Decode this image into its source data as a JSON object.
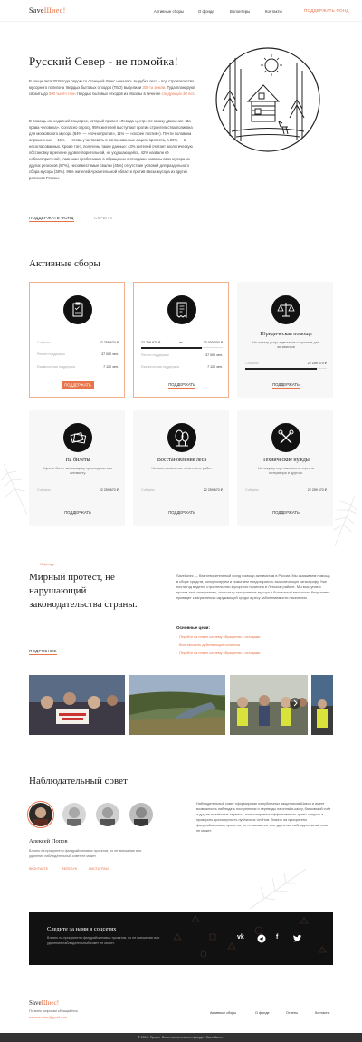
{
  "header": {
    "logo_a": "Save",
    "logo_b": "Шиес!",
    "nav": [
      "Активные сборы",
      "О фонде",
      "Волонтеры",
      "Контакты"
    ],
    "cta": "ПОДДЕРЖАТЬ ФОНД"
  },
  "hero": {
    "title": "Русский Север - не помойка!",
    "p1_a": "В конце лета 2018 года рядом со станцией Шиес началась вырубка леса - под строительство мусорного полигона твердых бытовых отходов (ТБО) выделили ",
    "p1_hl1": "300 га земли",
    "p1_b": ". Туда планируют свозить до ",
    "p1_hl2": "500 тысяч тонн",
    "p1_c": " твердых бытовых отходов из Москвы в течение ",
    "p1_hl3": "следующих 20 лет",
    "p1_d": ".",
    "p2": "В помощь им недавний соцопрос, который провел «Левада-центр» по заказу движения «За права человека». Согласно опросу, 95% жителей выступают против строительства полигона для московского мусора (84% — «точно против», 11% — «скорее против»). Почти половина опрошенных — 46% — готова участвовать в согласованных акциях протеста, а 25% — в несогласованных. Кроме того, получены такие данные: 43% жителей считает экологическую обстановку в регионе удовлетворительной, но ухудшающейся, 42% назвали её неблагоприятной; главными проблемами в обращении с отходами названы ввоз мусора из других регионов (67%), несовместимые свалки (45%) отсутствие условий для раздельного сбора мусора (38%). 96% жителей Архангельской области против ввоза мусора из других регионов России.",
    "support_link": "ПОДДЕРЖАТЬ ФОНД",
    "hide_link": "СКРЫТЬ"
  },
  "active": {
    "title": "Активные сборы",
    "cards": [
      {
        "icon": "clipboard-icon",
        "rows": [
          [
            "Собрано",
            "22 259 670 ₽"
          ],
          [
            "Регион поддержки",
            "37 000 чел."
          ],
          [
            "Ежемесячная поддержка",
            "7 120 чел."
          ]
        ],
        "btn": "ПОДДЕРЖАТЬ"
      },
      {
        "icon": "receipt-icon",
        "range_from": "22 259 670 ₽",
        "range_sep": "из",
        "range_to": "30 000 000 ₽",
        "progress": 0.74,
        "rows": [
          [
            "Регион поддержки",
            "37 000 чел."
          ],
          [
            "Ежемесячная поддержка",
            "7 120 чел."
          ]
        ],
        "btn": "ПОДДЕРЖАТЬ"
      },
      {
        "icon": "scales-icon",
        "title": "Юридическая помощь",
        "desc": "На оплату услуг адвокатов и юристов для активистов",
        "row": [
          "Собрано",
          "22 259 670 ₽"
        ],
        "progress": 0.88,
        "btn": "ПОДДЕРЖАТЬ"
      },
      {
        "icon": "tickets-icon",
        "title": "На билеты",
        "desc": "Купить билет желающему присоединиться активисту.",
        "row": [
          "Собрано",
          "22 259 670 ₽"
        ],
        "btn": "ПОДДЕРЖАТЬ"
      },
      {
        "icon": "trees-icon",
        "title": "Восстановление леса",
        "desc": "На восстановление леса после работ.",
        "row": [
          "Собрано",
          "22 259 670 ₽"
        ],
        "btn": "ПОДДЕРЖАТЬ"
      },
      {
        "icon": "tools-icon",
        "title": "Технические нужды",
        "desc": "На покупку спутникового интернета генератора и другого.",
        "row": [
          "Собрано",
          "22 259 670 ₽"
        ],
        "btn": "ПОДДЕРЖАТЬ"
      }
    ]
  },
  "about": {
    "kicker": "О фонде",
    "title": "Мирный протест, не нарушающий законодательства страны.",
    "more": "ПОДРОБНЕЕ",
    "p": "SaveШиес — благотворительный фонд помощи активистам в России. Мы оказываем помощь в сборе средств, консультируем и помогаем предотвратить экологическую катастрофу. Уже почти год ведется строительство мусорного полигона в Ленском районе. Мы выступаем против этой инициативы, поскольку захоронение мусора в болотистой местности безусловно приведет к загрязнению окружающей среды и ресу заболеваемости населения.",
    "goals_title": "Основные цели:",
    "goals": [
      "Перейти на новую систему обращения с отходами",
      "Восстановить действующие полигоны",
      "Перейти на новую систему обращения с отходами"
    ]
  },
  "council": {
    "title": "Наблюдательный совет",
    "member_name": "Алексей Попов",
    "member_p": "Влиять на приоритеты фандрайзинговых проектов, но не вмешение или удаление наблюдательный совет не может.",
    "tags": [
      "ВКОНТАКТЕ",
      "ФЕЙСБУК",
      "ИНСТАГРАМ"
    ],
    "p": "Наблюдательный совет сформирован из публичных защитников Шиеса и имеет возможность наблюдать поступления и переводы на онлайн-кассу, банковский счёт и другие платёжные сервисы, контролировать эффективность траты средств и проверить достоверность публичных отчётов. Влиять на приоритеты фандрайзинговых проектов, но не вмешение или удаление наблюдательный совет не может."
  },
  "social": {
    "title": "Следите за нами в соцсетях",
    "p": "Влиять на приоритеты фандрайзинговых проектов, но не вмешение или удаление наблюдательный совет не может.",
    "icons": [
      "vk-icon",
      "telegram-icon",
      "facebook-icon",
      "twitter-icon"
    ]
  },
  "footer": {
    "logo_a": "Save",
    "logo_b": "Шиес!",
    "q": "По всем вопросам обращайтесь",
    "mail": "на save.shies@gmail.com",
    "nav": [
      "Активные сборы",
      "О фонде",
      "Отчеты",
      "Контакты"
    ],
    "copy": "© 2019. Проект Благотворительного фонда «SaveШиес»."
  },
  "colors": {
    "accent": "#e8744a",
    "dark": "#111111"
  }
}
